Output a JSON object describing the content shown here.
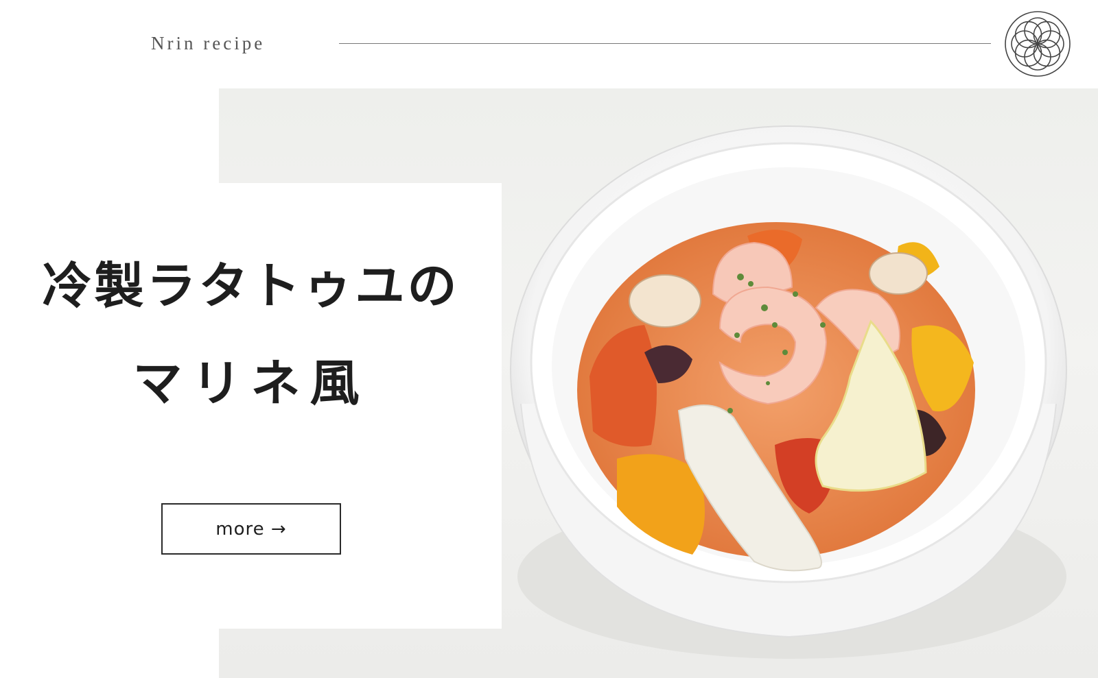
{
  "header": {
    "brand": "Nrin recipe",
    "logo_icon": "flower-of-life-icon"
  },
  "hero": {
    "title_line1": "冷製ラタトゥユの",
    "title_line2": "マリネ風",
    "more_label": "more →",
    "photo_subject": "food-photo-ratatouille-bowl"
  },
  "colors": {
    "text": "#1e1e1e",
    "rule": "#777777",
    "background": "#ffffff"
  }
}
